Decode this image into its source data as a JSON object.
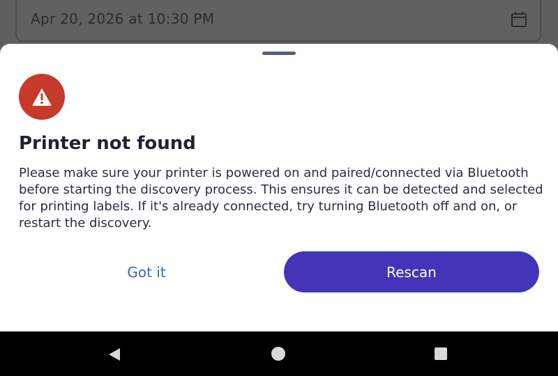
{
  "background": {
    "date_field_value": "Apr 20, 2026 at 10:30 PM",
    "date_field_icon": "calendar-icon"
  },
  "sheet": {
    "icon": "warning-icon",
    "accent_color": "#c7392b",
    "title": "Printer not found",
    "message": "Please make sure your printer is powered on and paired/connected via Bluetooth before starting the discovery process. This ensures it can be detected and selected for printing labels. If it's already connected, try turning Bluetooth off and on, or restart the discovery.",
    "secondary_button": "Got it",
    "primary_button": "Rescan",
    "primary_color": "#4335b8"
  },
  "navbar": {
    "back_icon": "back-triangle-icon",
    "home_icon": "home-circle-icon",
    "recents_icon": "recents-square-icon"
  }
}
